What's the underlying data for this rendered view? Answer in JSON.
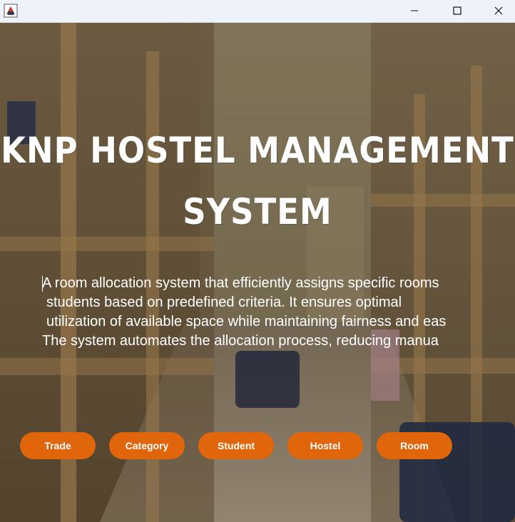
{
  "window": {
    "app_icon": "java-app-icon",
    "controls": [
      "minimize-icon",
      "maximize-icon",
      "close-icon"
    ]
  },
  "hero": {
    "title_line1": "KNP HOSTEL MANAGEMENT",
    "title_line2": "SYSTEM",
    "description": [
      "A room allocation system that efficiently assigns specific rooms",
      "students based on predefined criteria. It ensures optimal",
      "utilization of available space while maintaining fairness and eas",
      "The system automates the allocation process, reducing manua"
    ]
  },
  "nav": {
    "trade": "Trade",
    "category": "Category",
    "student": "Student",
    "hostel": "Hostel",
    "room": "Room"
  },
  "colors": {
    "button": "#e0650b",
    "titlebar": "#eef2f9",
    "text": "#ffffff"
  }
}
